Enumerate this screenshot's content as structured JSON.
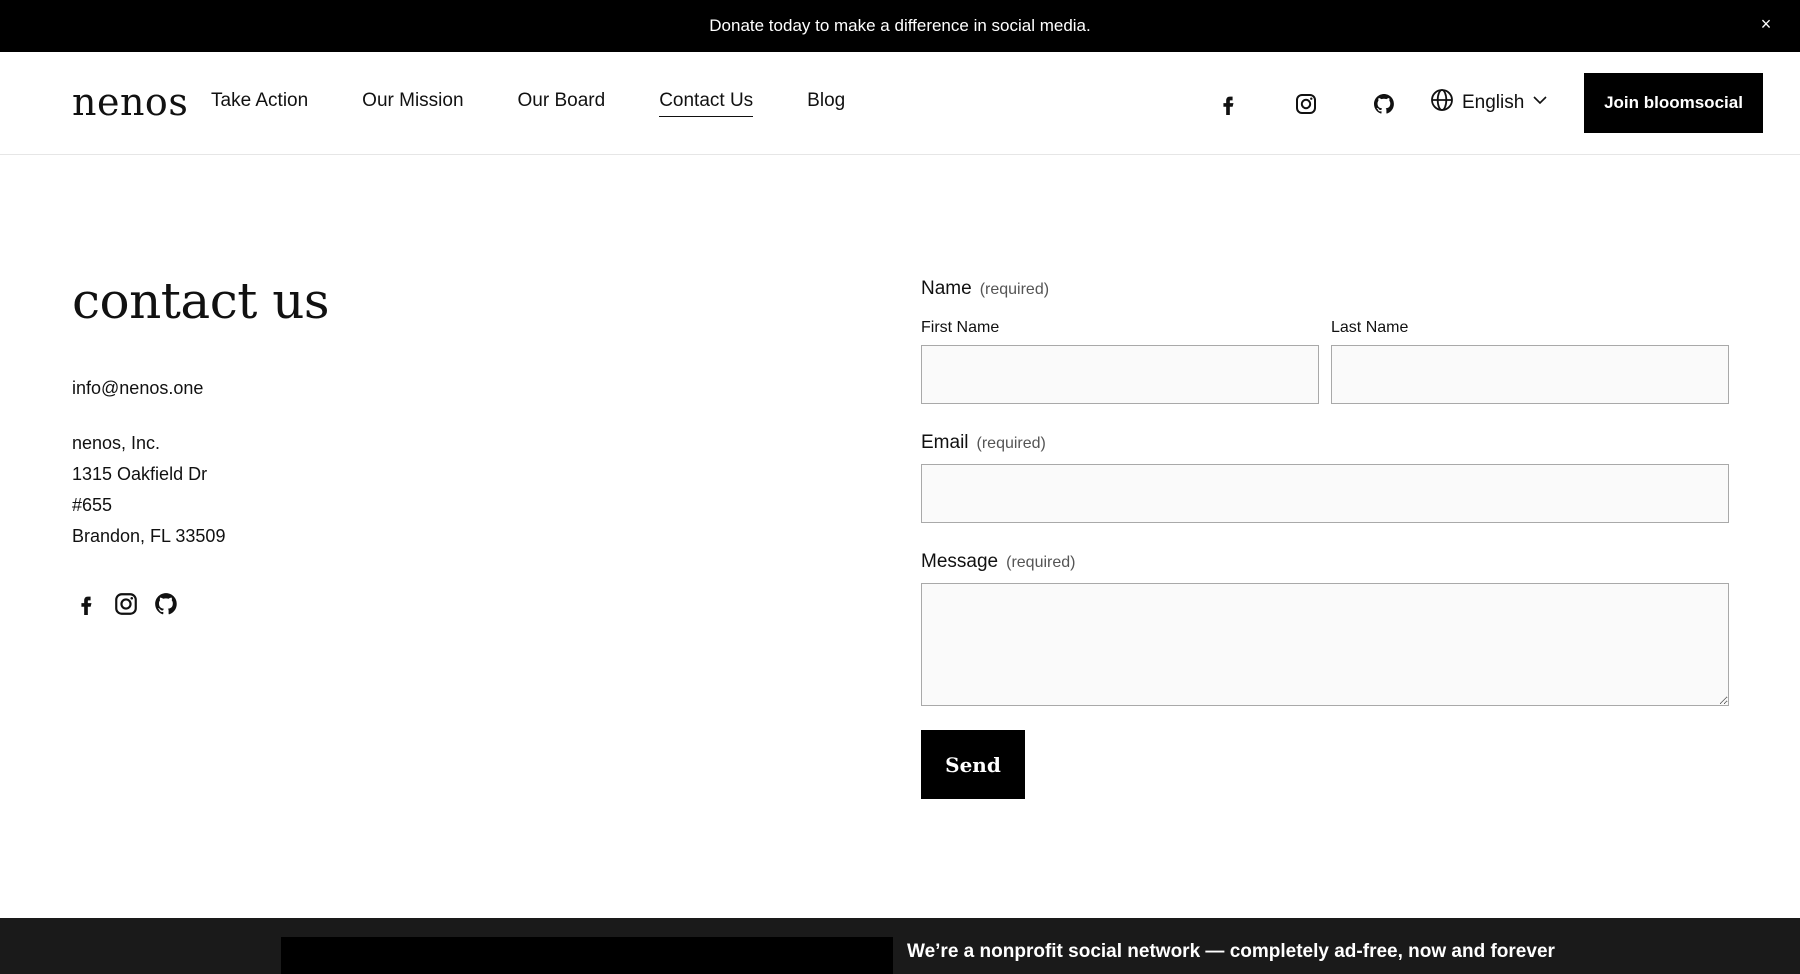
{
  "announcement": {
    "text": "Donate today to make a difference in social media.",
    "close_symbol": "×"
  },
  "header": {
    "logo": "nenos",
    "nav": [
      {
        "label": "Take Action",
        "active": false
      },
      {
        "label": "Our Mission",
        "active": false
      },
      {
        "label": "Our Board",
        "active": false
      },
      {
        "label": "Contact Us",
        "active": true
      },
      {
        "label": "Blog",
        "active": false
      }
    ],
    "social_icons": [
      "facebook-icon",
      "instagram-icon",
      "github-icon"
    ],
    "language": "English",
    "join_label": "Join bloomsocial"
  },
  "contact": {
    "title": "contact us",
    "email": "info@nenos.one",
    "address_lines": [
      "nenos, Inc.",
      "1315 Oakfield Dr",
      "#655",
      "Brandon, FL 33509"
    ],
    "social_icons": [
      "facebook-icon",
      "instagram-icon",
      "github-icon"
    ]
  },
  "form": {
    "name_label": "Name",
    "required_text": "(required)",
    "first_name_label": "First Name",
    "last_name_label": "Last Name",
    "first_name_value": "",
    "last_name_value": "",
    "email_label": "Email",
    "email_value": "",
    "message_label": "Message",
    "message_value": "",
    "send_label": "Send"
  },
  "footer": {
    "text": "We’re a nonprofit social network — completely ad-free, now and forever"
  },
  "colors": {
    "primary": "#000000",
    "background": "#ffffff",
    "input_background": "#fafafa",
    "input_border": "#a9a9a9",
    "footer_background": "#1a1a1a"
  }
}
